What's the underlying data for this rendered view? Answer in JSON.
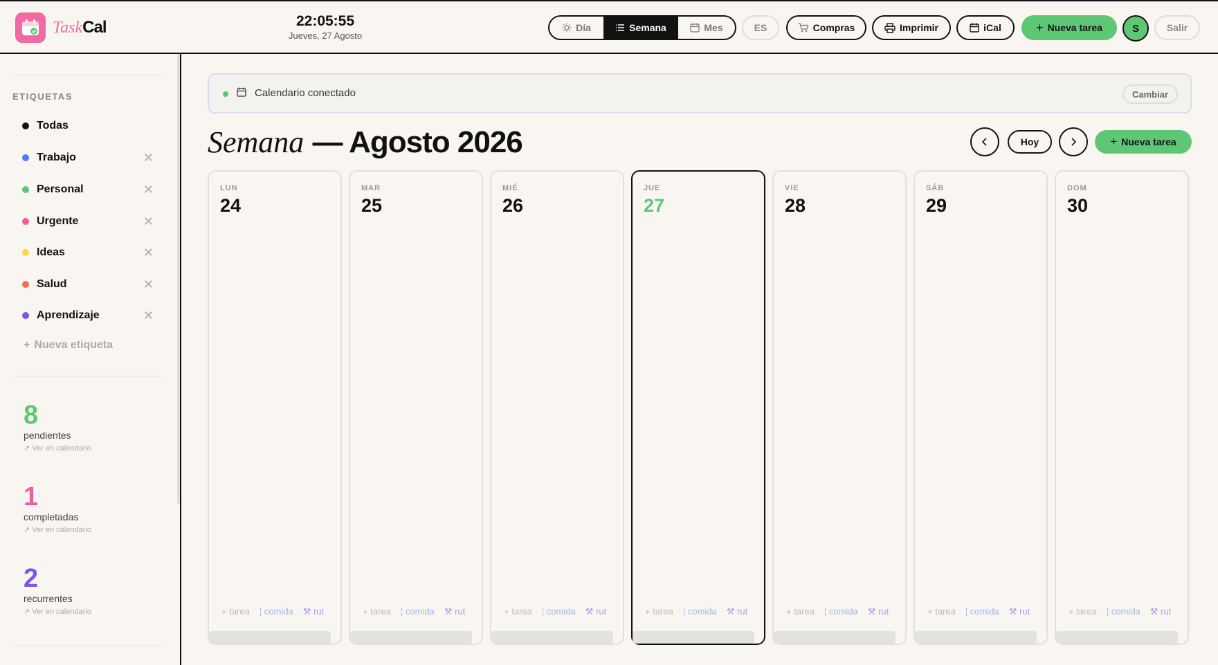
{
  "header": {
    "logo_task": "Task",
    "logo_cal": "Cal",
    "time": "22:05:55",
    "date": "Jueves, 27 Agosto",
    "view_day": "Día",
    "view_week": "Semana",
    "view_month": "Mes",
    "lang": "ES",
    "shopping": "Compras",
    "print": "Imprimir",
    "ical": "iCal",
    "new_task": "Nueva tarea",
    "avatar": "S",
    "logout": "Salir"
  },
  "sidebar": {
    "section_title": "ETIQUETAS",
    "tags": [
      {
        "label": "Todas",
        "color": "#111111"
      },
      {
        "label": "Trabajo",
        "color": "#4c7cf0"
      },
      {
        "label": "Personal",
        "color": "#5ec776"
      },
      {
        "label": "Urgente",
        "color": "#ef5f9e"
      },
      {
        "label": "Ideas",
        "color": "#f5d949"
      },
      {
        "label": "Salud",
        "color": "#f0704c"
      },
      {
        "label": "Aprendizaje",
        "color": "#7b57e8"
      }
    ],
    "new_tag": "Nueva etiqueta",
    "stats": [
      {
        "num": "8",
        "label": "pendientes",
        "link": "Ver en calendario",
        "color": "#5ec776"
      },
      {
        "num": "1",
        "label": "completadas",
        "link": "Ver en calendario",
        "color": "#ef5f9e"
      },
      {
        "num": "2",
        "label": "recurrentes",
        "link": "Ver en calendario",
        "color": "#7b57e8"
      }
    ]
  },
  "banner": {
    "text": "Calendario conectado",
    "change": "Cambiar"
  },
  "main": {
    "title_week": "Semana",
    "title_rest": "— Agosto 2026",
    "today_btn": "Hoy",
    "new_task": "Nueva tarea",
    "action_task": "tarea",
    "action_meal": "comida",
    "action_rut": "rut",
    "days": [
      {
        "name": "LUN",
        "num": "24"
      },
      {
        "name": "MAR",
        "num": "25"
      },
      {
        "name": "MIÉ",
        "num": "26"
      },
      {
        "name": "JUE",
        "num": "27"
      },
      {
        "name": "VIE",
        "num": "28"
      },
      {
        "name": "SÁB",
        "num": "29"
      },
      {
        "name": "DOM",
        "num": "30"
      }
    ]
  }
}
